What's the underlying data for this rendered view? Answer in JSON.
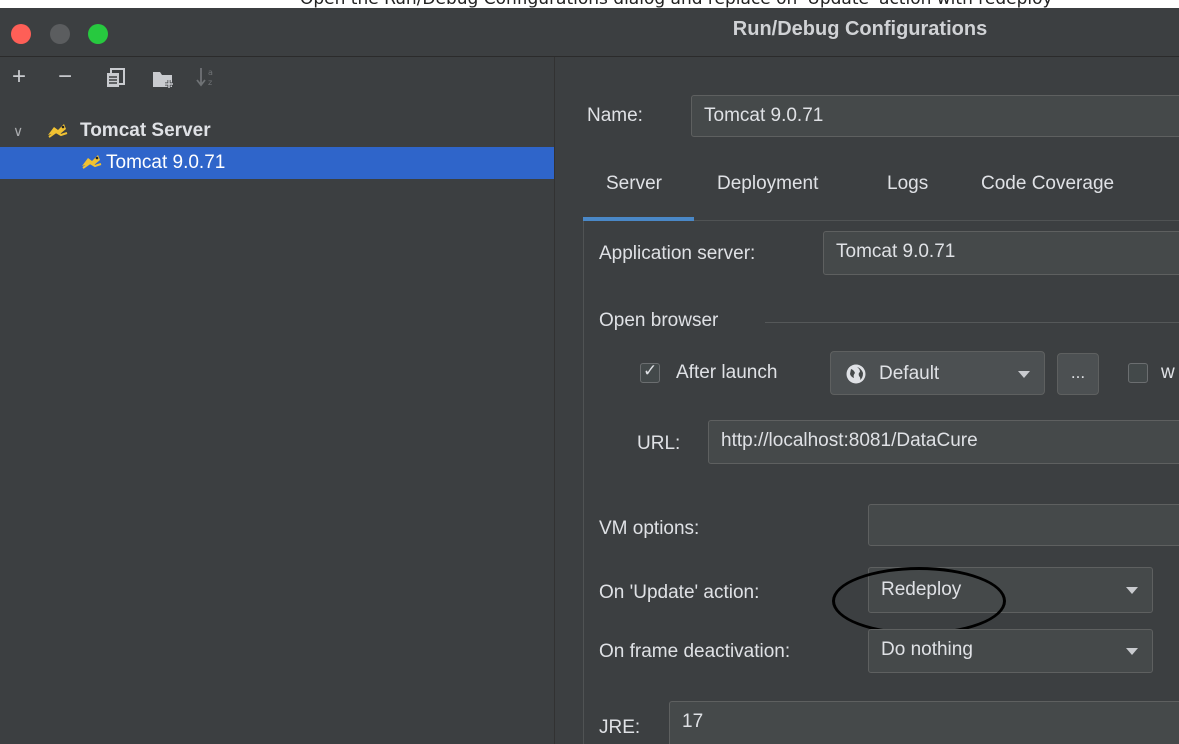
{
  "top_text": "Open the Run/Debug Configurations dialog and replace on 'Update' action with redeploy",
  "window": {
    "title": "Run/Debug Configurations"
  },
  "toolbar": {
    "add": "+",
    "remove": "−"
  },
  "tree": {
    "group_label": "Tomcat Server",
    "item_label": "Tomcat 9.0.71"
  },
  "config": {
    "name_label": "Name:",
    "name_value": "Tomcat 9.0.71",
    "tabs": [
      "Server",
      "Deployment",
      "Logs",
      "Code Coverage"
    ],
    "active_tab": "Server",
    "app_server_label": "Application server:",
    "app_server_value": "Tomcat 9.0.71",
    "open_browser_label": "Open browser",
    "after_launch_label": "After launch",
    "after_launch_checked": true,
    "browser_value": "Default",
    "more_button": "...",
    "with_js_label": "w",
    "url_label": "URL:",
    "url_value": "http://localhost:8081/DataCure",
    "vm_options_label": "VM options:",
    "vm_options_value": "",
    "update_action_label": "On 'Update' action:",
    "update_action_value": "Redeploy",
    "frame_deactivation_label": "On frame deactivation:",
    "frame_deactivation_value": "Do nothing",
    "jre_label": "JRE:",
    "jre_value": "17"
  },
  "colors": {
    "background": "#3c3f41",
    "selection": "#2f65ca",
    "accent": "#4a88c7"
  },
  "annotation": {
    "shape": "ellipse",
    "color": "#000000",
    "target": "update-action-select"
  }
}
